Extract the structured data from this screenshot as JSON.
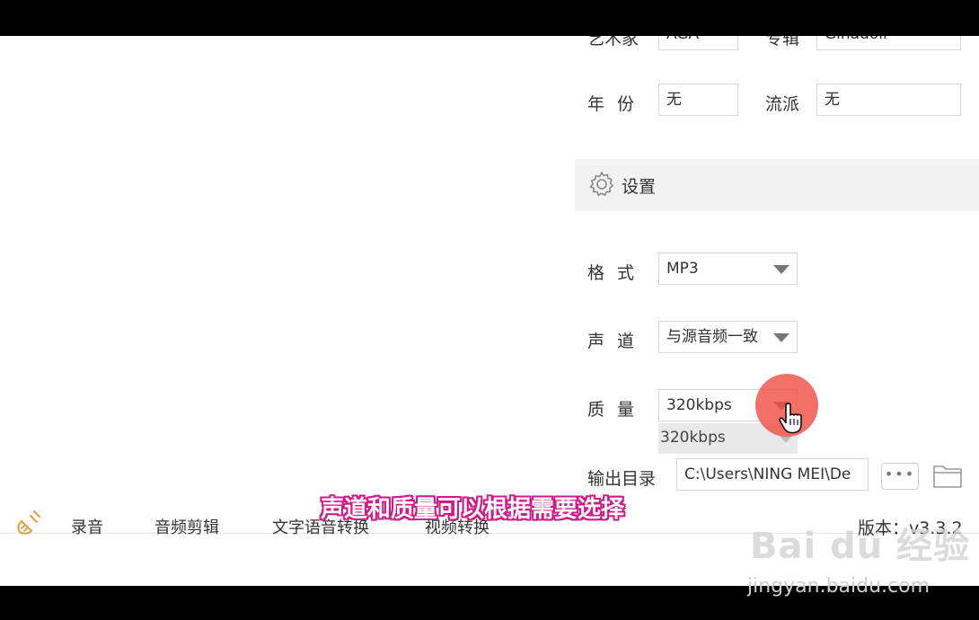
{
  "metadata_panel": {
    "artist_label": "艺术家",
    "artist_value": "AGA",
    "album_label": "专辑",
    "album_value": "Ginadoll",
    "year_label": "年份",
    "year_value": "无",
    "genre_label": "流派",
    "genre_value": "无"
  },
  "settings": {
    "title": "设置",
    "format_label": "格式",
    "format_value": "MP3",
    "channel_label": "声道",
    "channel_value": "与源音频一致",
    "quality_label": "质量",
    "quality_value": "320kbps",
    "quality_dropdown_option": "320kbps",
    "output_label": "输出目录",
    "output_value": "C:\\Users\\NING MEI\\De",
    "more_button": "•••"
  },
  "toolbar": {
    "items": [
      "录音",
      "音频剪辑",
      "文字语音转换",
      "视频转换"
    ],
    "version": "版本：v3.3.2"
  },
  "overlay": {
    "subtitle": "声道和质量可以根据需要选择",
    "watermark": "Bai du 经验",
    "watermark_url": "jingyan.baidu.com"
  },
  "colors": {
    "highlight_circle": "#f05046",
    "subtitle_outline": "#d11a8a"
  }
}
